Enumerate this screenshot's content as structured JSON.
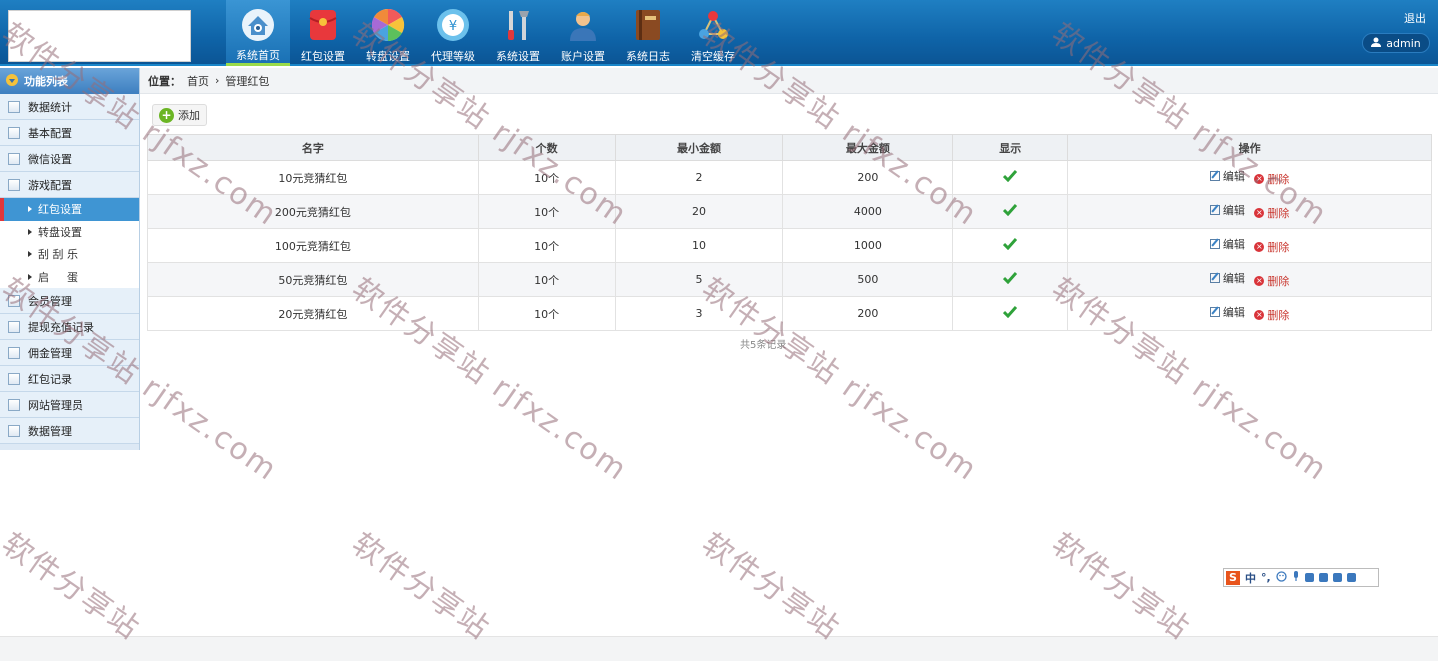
{
  "header": {
    "nav": [
      {
        "label": "系统首页",
        "icon": "home-icon",
        "active": true
      },
      {
        "label": "红包设置",
        "icon": "red-envelope-icon",
        "active": false
      },
      {
        "label": "转盘设置",
        "icon": "wheel-icon",
        "active": false
      },
      {
        "label": "代理等级",
        "icon": "agent-level-icon",
        "active": false
      },
      {
        "label": "系统设置",
        "icon": "tools-icon",
        "active": false
      },
      {
        "label": "账户设置",
        "icon": "user-account-icon",
        "active": false
      },
      {
        "label": "系统日志",
        "icon": "log-book-icon",
        "active": false
      },
      {
        "label": "清空缓存",
        "icon": "clear-cache-icon",
        "active": false
      }
    ],
    "logout": "退出",
    "user": "admin"
  },
  "sidebar": {
    "title": "功能列表",
    "items_top": [
      "数据统计",
      "基本配置",
      "微信设置",
      "游戏配置"
    ],
    "subitems": [
      "红包设置",
      "转盘设置",
      "刮 刮 乐",
      "启 　 蛋"
    ],
    "items_bottom": [
      "会员管理",
      "提现充值记录",
      "佣金管理",
      "红包记录",
      "网站管理员",
      "数据管理"
    ]
  },
  "breadcrumb": {
    "label": "位置：",
    "home": "首页",
    "sep": "›",
    "current": "管理红包"
  },
  "toolbar": {
    "add": "添加"
  },
  "table": {
    "headers": [
      "名字",
      "个数",
      "最小金额",
      "最大金额",
      "显示",
      "操作"
    ],
    "rows": [
      {
        "name": "10元竞猜红包",
        "count": "10个",
        "min": "2",
        "max": "200"
      },
      {
        "name": "200元竞猜红包",
        "count": "10个",
        "min": "20",
        "max": "4000"
      },
      {
        "name": "100元竞猜红包",
        "count": "10个",
        "min": "10",
        "max": "1000"
      },
      {
        "name": "50元竞猜红包",
        "count": "10个",
        "min": "5",
        "max": "500"
      },
      {
        "name": "20元竞猜红包",
        "count": "10个",
        "min": "3",
        "max": "200"
      }
    ],
    "edit_label": "编辑",
    "delete_label": "删除",
    "total": "共5条记录"
  },
  "ime": {
    "lang": "中",
    "punct": "°,"
  },
  "watermark": {
    "cn": "软件分享站",
    "en": "rjfxz.com"
  },
  "colors": {
    "header": "#1570b5",
    "accent_green": "#9adb4a",
    "active_menu": "#3f95d3",
    "danger": "#d9343a"
  }
}
